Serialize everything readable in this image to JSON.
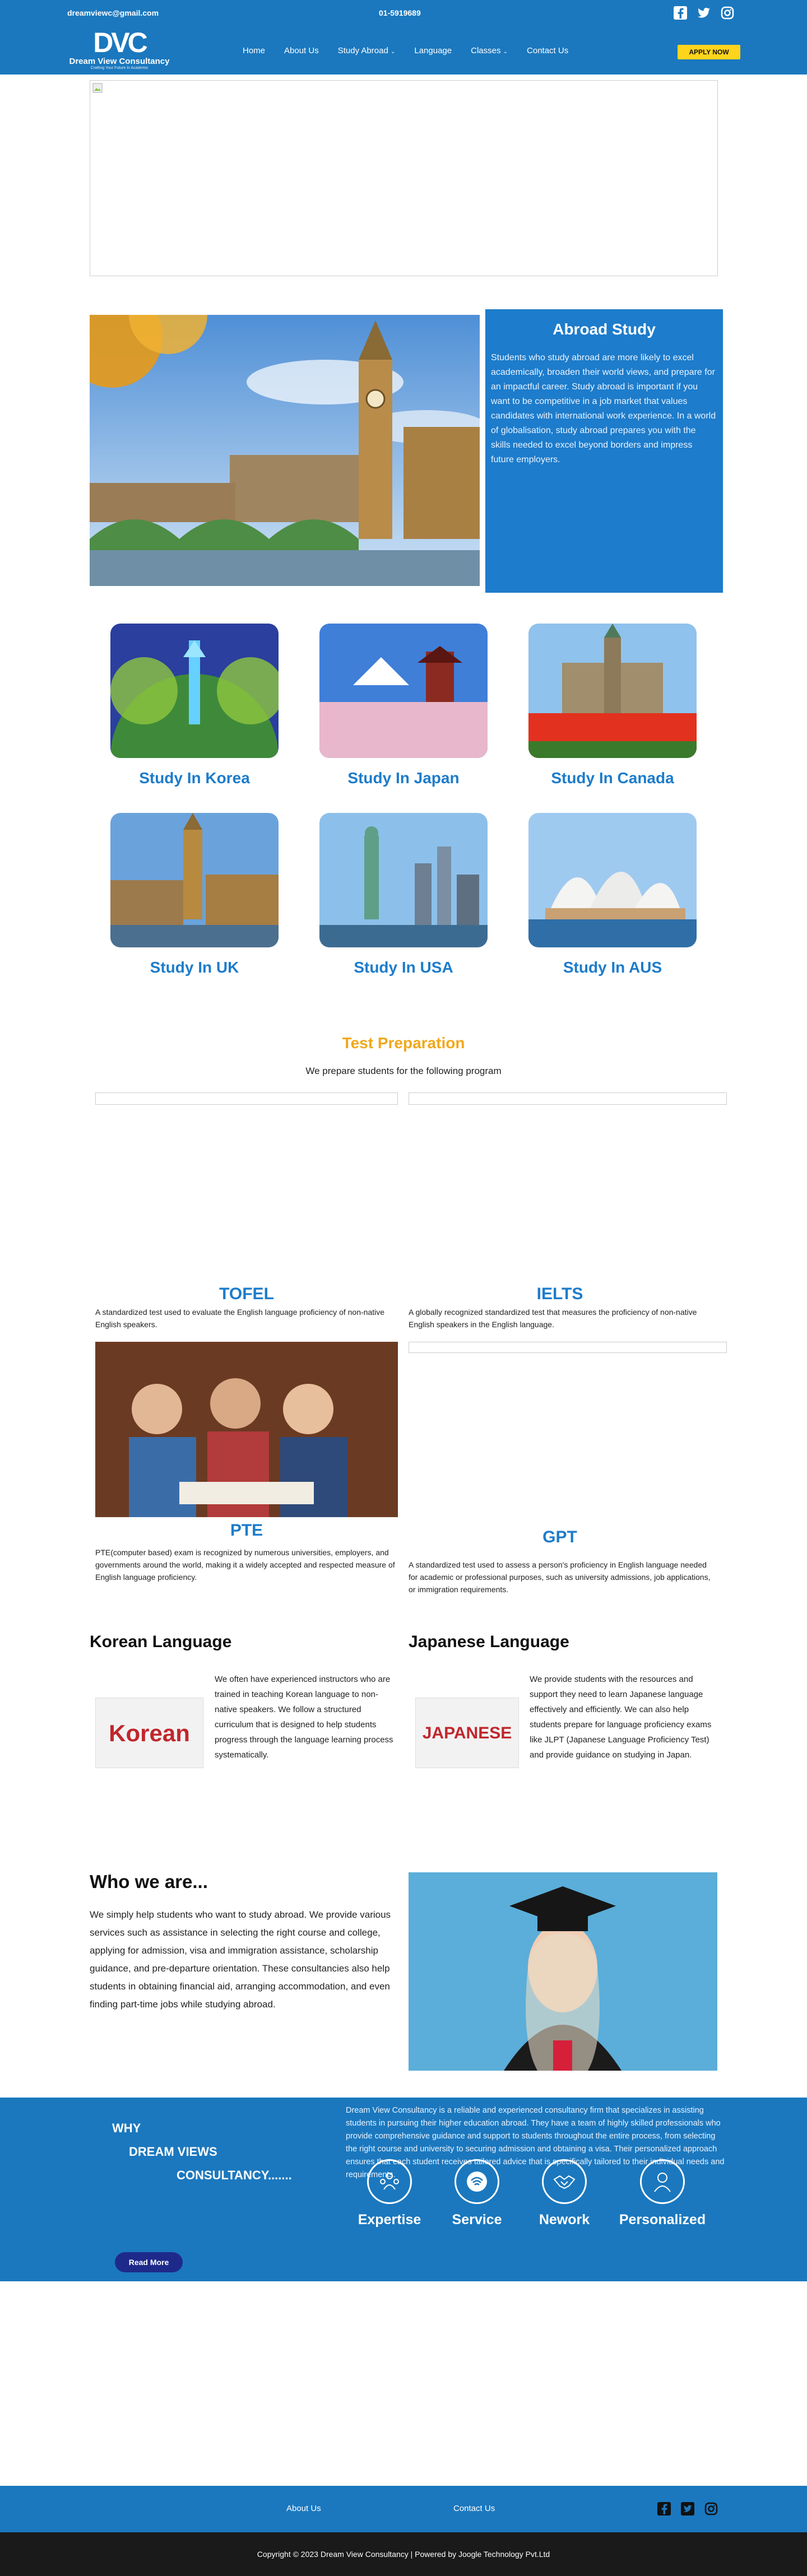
{
  "topbar": {
    "email": "dreamviewc@gmail.com",
    "phone": "01-5919689"
  },
  "brand": {
    "name": "Dream View Consultancy",
    "tagline": "Crafting Your Future In Academic"
  },
  "nav": {
    "items": [
      "Home",
      "About Us",
      "Study Abroad",
      "Language",
      "Classes",
      "Contact Us"
    ],
    "apply": "APPLY NOW"
  },
  "abroad": {
    "title": "Abroad Study",
    "text": "Students who study abroad are more likely to excel academically, broaden their world views, and prepare for an impactful career. Study abroad is important if you want to be competitive in a job market that values candidates with international work experience. In a world of globalisation, study abroad prepares you with the skills needed to excel beyond borders and impress future employers."
  },
  "countries": [
    "Study In Korea",
    "Study In Japan",
    "Study In Canada",
    "Study In UK",
    "Study In USA",
    "Study In AUS"
  ],
  "tests": {
    "title": "Test Preparation",
    "subtitle": "We prepare students for the following program",
    "items": [
      {
        "name": "TOFEL",
        "text": "A standardized test used to evaluate the English language proficiency of non-native English speakers."
      },
      {
        "name": "IELTS",
        "text": "A globally recognized standardized test that measures the proficiency of non-native English speakers in the English language."
      },
      {
        "name": "PTE",
        "text": "PTE(computer based) exam is recognized by numerous universities, employers, and governments around the world, making it a widely accepted and respected measure of English language proficiency."
      },
      {
        "name": "GPT",
        "text": "A standardized test used to assess a person's proficiency in English language needed for academic or professional purposes, such as university admissions, job applications, or immigration requirements."
      }
    ]
  },
  "languages": [
    {
      "title": "Korean Language",
      "image_word": "Korean",
      "text": "We often have experienced instructors who are trained in teaching Korean language to non-native speakers. We follow a structured curriculum that is designed to help students progress through the language learning process systematically."
    },
    {
      "title": "Japanese Language",
      "image_word": "JAPANESE",
      "text": "We provide students with the resources and support they need to learn Japanese language effectively and efficiently. We can also help students prepare for language proficiency exams like JLPT (Japanese Language Proficiency Test) and provide guidance on studying in Japan."
    }
  ],
  "who": {
    "title": "Who we are...",
    "text": "We simply help students who want to study abroad. We provide various services such as assistance in selecting the right course and college, applying for admission, visa and immigration assistance, scholarship guidance, and pre-departure orientation. These consultancies also help students in obtaining financial aid, arranging accommodation, and even finding part-time jobs while studying abroad."
  },
  "why": {
    "line1": "WHY",
    "line2": "DREAM VIEWS",
    "line3": "CONSULTANCY.......",
    "text": "Dream View Consultancy is a reliable and experienced consultancy firm that specializes in assisting students in pursuing their higher education abroad. They have a team of highly skilled professionals who provide comprehensive guidance and support to students throughout the entire process, from selecting the right course and university to securing admission and obtaining a visa. Their personalized approach ensures that each student receives tailored advice that is specifically tailored to their individual needs and requirements.",
    "features": [
      "Expertise",
      "Service",
      "Nework",
      "Personalized"
    ],
    "read_more": "Read More"
  },
  "footer": {
    "about": "About Us",
    "contact": "Contact Us",
    "copyright": "Copyright © 2023 Dream View Consultancy | Powered by Joogle Technology Pvt.Ltd"
  },
  "colors": {
    "primary": "#1b78be",
    "accent": "#f0a81c",
    "button": "#ffd41c"
  }
}
